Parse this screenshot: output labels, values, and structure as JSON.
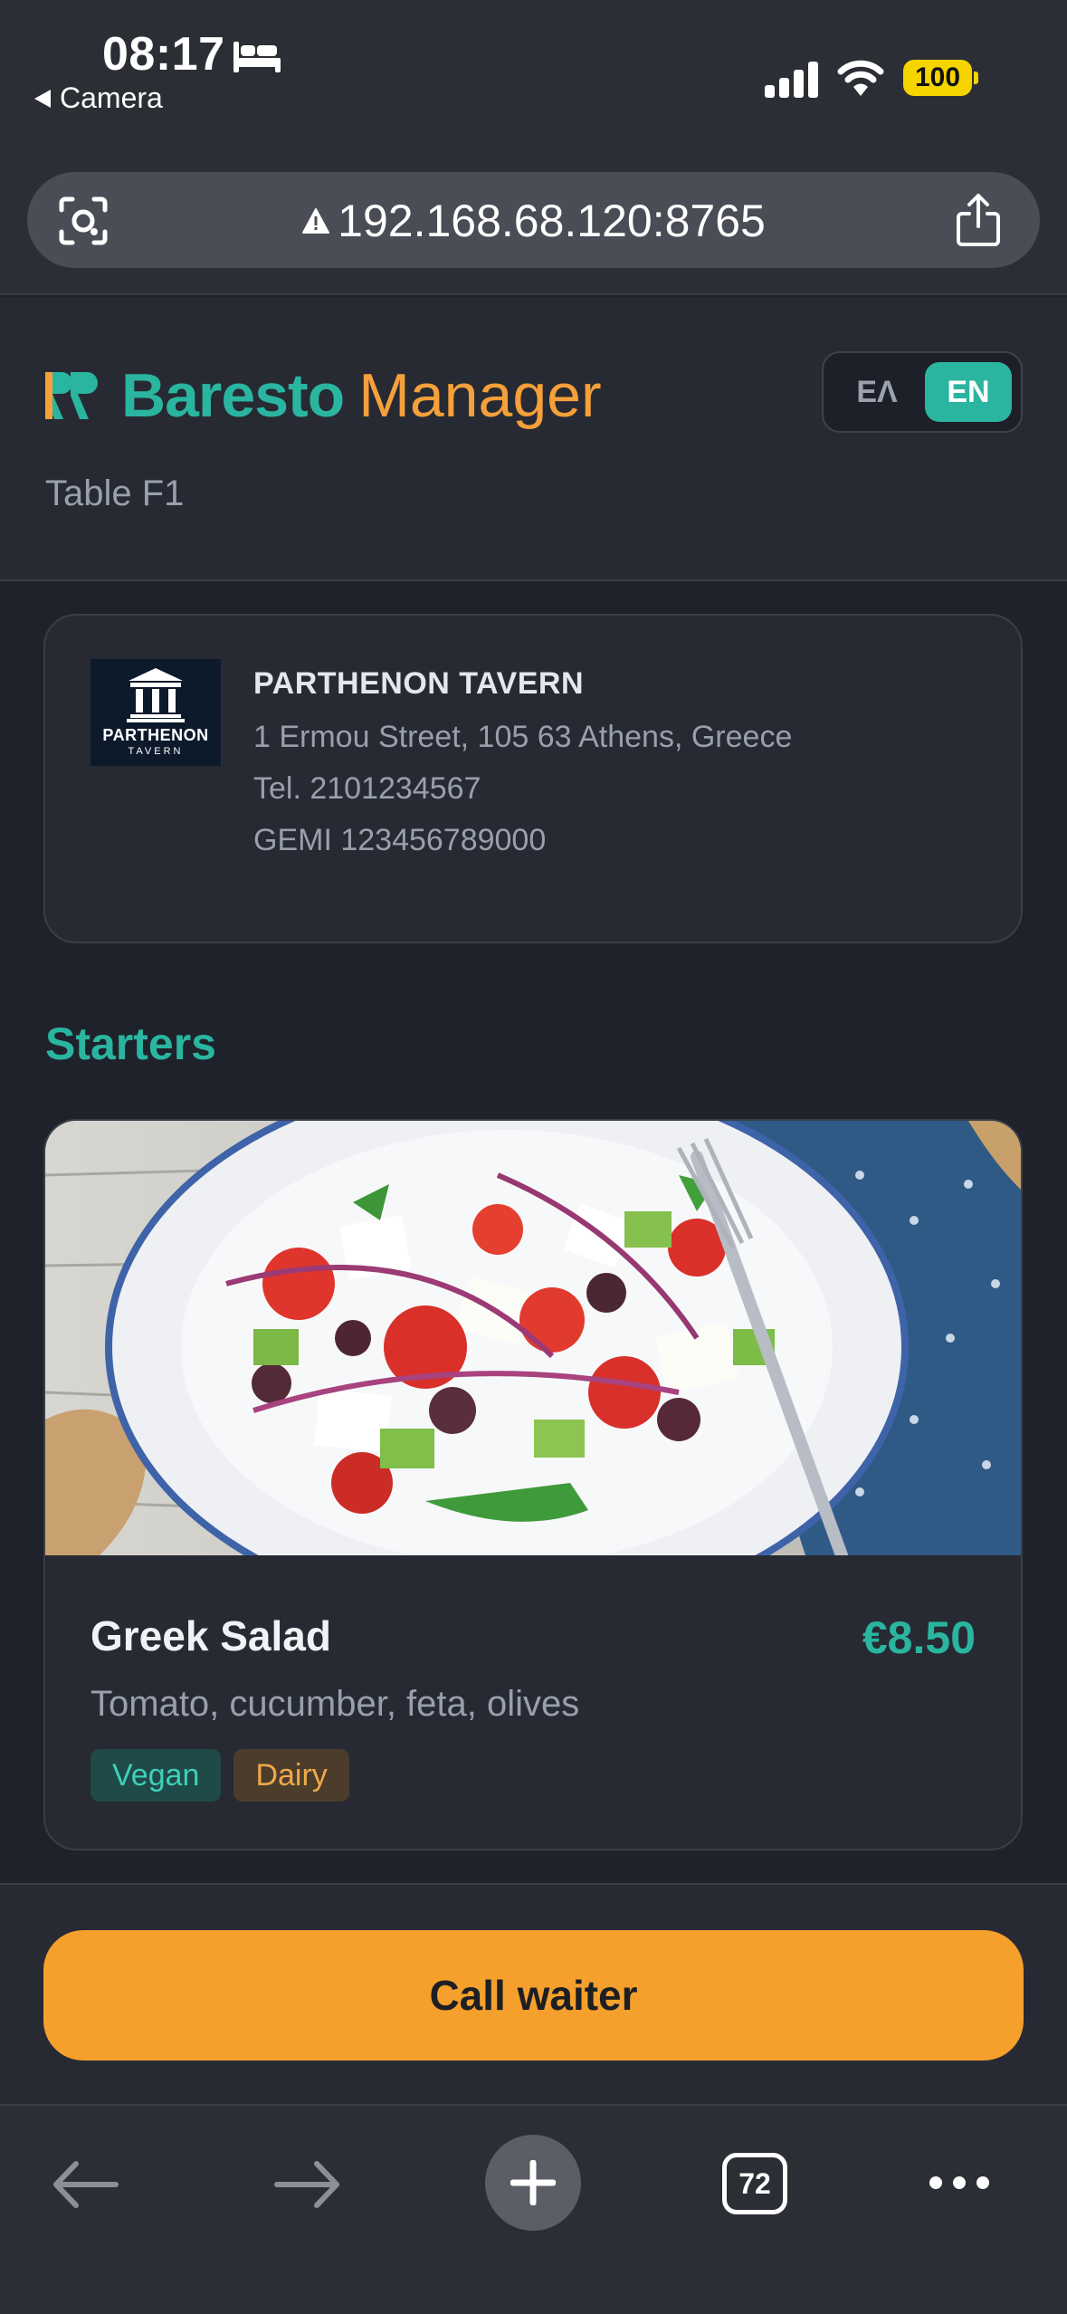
{
  "status_bar": {
    "time": "08:17",
    "back_app": "Camera",
    "battery": "100"
  },
  "browser": {
    "url": "192.168.68.120:8765",
    "open_tabs": "72"
  },
  "header": {
    "brand_primary": "Baresto",
    "brand_secondary": "Manager",
    "lang_options": [
      "ΕΛ",
      "EN"
    ],
    "lang_selected": "EN",
    "table_label": "Table F1"
  },
  "venue": {
    "logo_name": "PARTHENON",
    "logo_sub": "TAVERN",
    "name": "PARTHENON TAVERN",
    "address": "1 Ermou Street, 105 63 Athens, Greece",
    "phone": "Tel. 2101234567",
    "gemi": "GEMI 123456789000"
  },
  "menu": {
    "section_title": "Starters",
    "items": [
      {
        "name": "Greek Salad",
        "price": "€8.50",
        "description": "Tomato, cucumber, feta, olives",
        "tags": [
          "Vegan",
          "Dairy"
        ]
      }
    ]
  },
  "footer": {
    "call_waiter_label": "Call waiter"
  },
  "colors": {
    "accent_teal": "#2ab5a0",
    "accent_orange": "#f5a02c",
    "background": "#1f222b",
    "card": "#272a33"
  },
  "icons": [
    "bed-icon",
    "signal-icon",
    "wifi-icon",
    "lens-icon",
    "warning-icon",
    "share-icon",
    "back-arrow-icon",
    "forward-arrow-icon",
    "plus-icon",
    "more-icon"
  ]
}
